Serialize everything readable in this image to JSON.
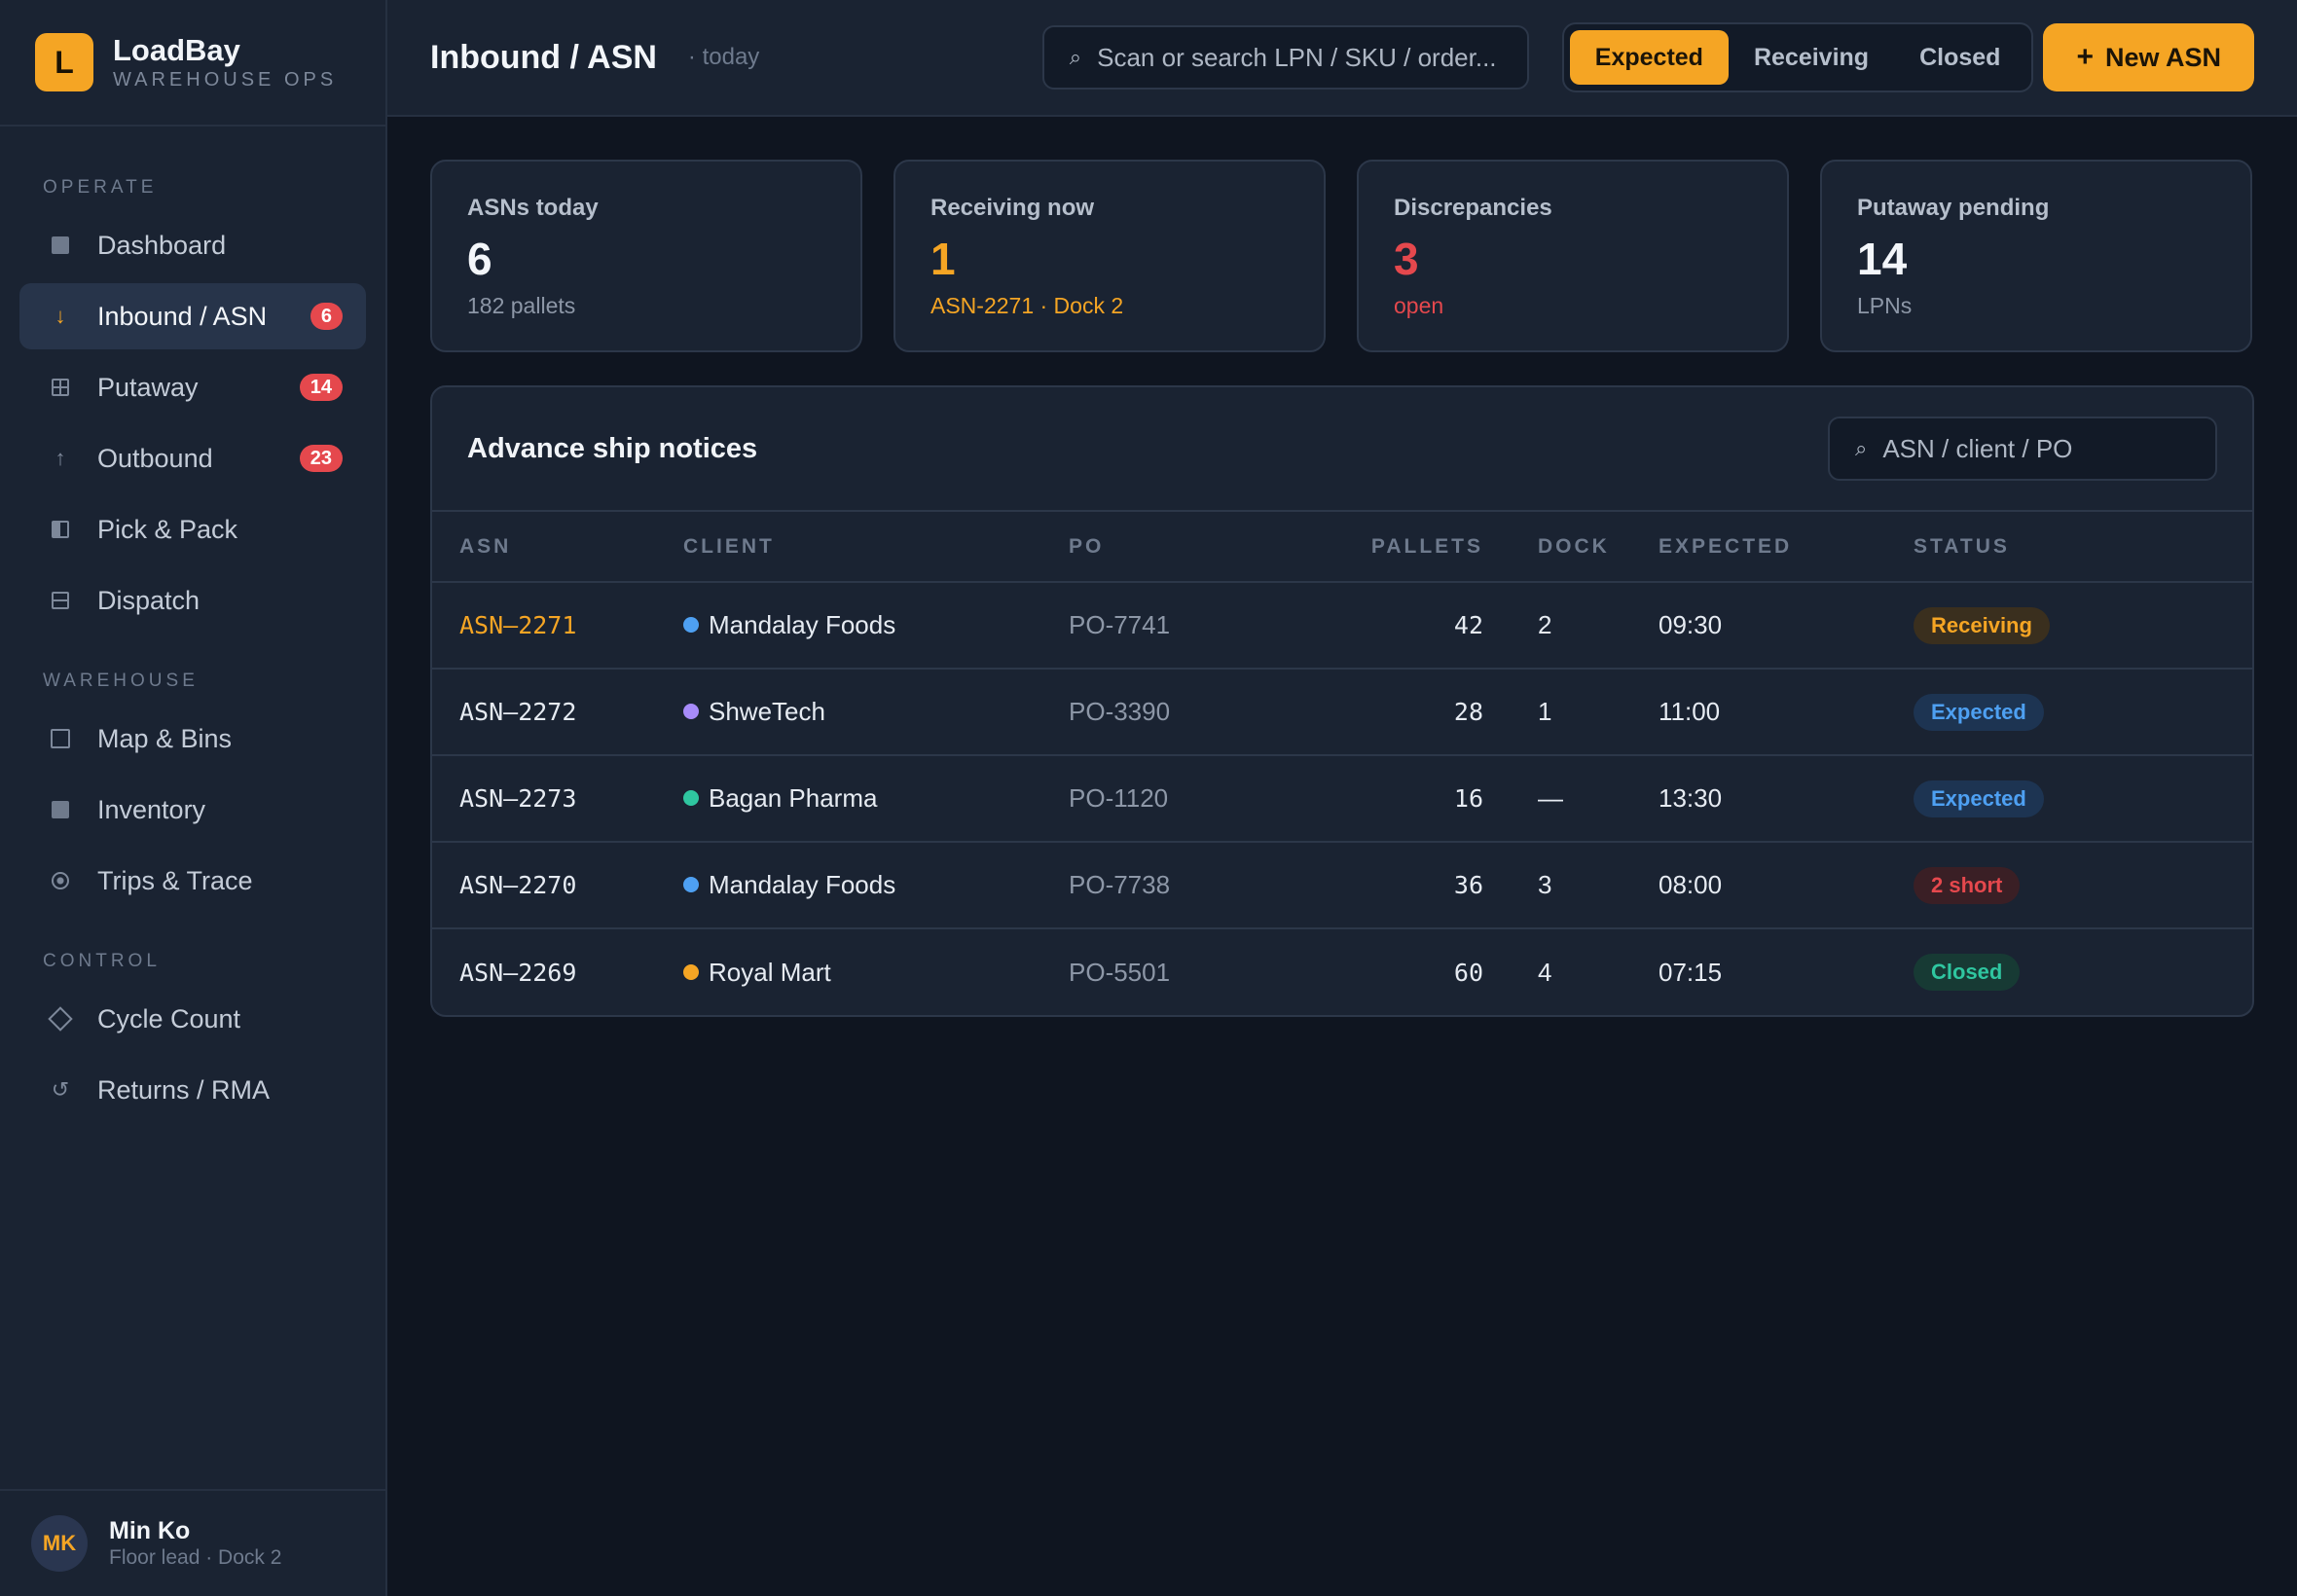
{
  "brand": {
    "logo_letter": "L",
    "name": "LoadBay",
    "subtitle": "WAREHOUSE OPS"
  },
  "nav": {
    "sections": [
      {
        "label": "OPERATE"
      },
      {
        "label": "WAREHOUSE"
      },
      {
        "label": "CONTROL"
      }
    ],
    "items": [
      {
        "label": "Dashboard",
        "icon": "dashboard-icon"
      },
      {
        "label": "Inbound / ASN",
        "icon": "arrow-down-icon",
        "badge": "6",
        "active": true
      },
      {
        "label": "Putaway",
        "icon": "grid-icon",
        "badge": "14"
      },
      {
        "label": "Outbound",
        "icon": "arrow-up-icon",
        "badge": "23"
      },
      {
        "label": "Pick & Pack",
        "icon": "pick-pack-icon"
      },
      {
        "label": "Dispatch",
        "icon": "dispatch-icon"
      },
      {
        "label": "Map & Bins",
        "icon": "map-icon"
      },
      {
        "label": "Inventory",
        "icon": "inventory-icon"
      },
      {
        "label": "Trips & Trace",
        "icon": "trace-icon"
      },
      {
        "label": "Cycle Count",
        "icon": "diamond-icon"
      },
      {
        "label": "Returns / RMA",
        "icon": "returns-icon"
      }
    ]
  },
  "user": {
    "initials": "MK",
    "name": "Min Ko",
    "role": "Floor lead · Dock 2"
  },
  "header": {
    "title": "Inbound / ASN",
    "subtitle": "· today",
    "search_placeholder": "Scan or search LPN / SKU / order...",
    "filters": [
      "Expected",
      "Receiving",
      "Closed"
    ],
    "active_filter": "Expected",
    "new_button": "New ASN"
  },
  "stats": [
    {
      "label": "ASNs today",
      "value": "6",
      "note": "182 pallets"
    },
    {
      "label": "Receiving now",
      "value": "1",
      "note": "ASN-2271 · Dock 2"
    },
    {
      "label": "Discrepancies",
      "value": "3",
      "note": "open"
    },
    {
      "label": "Putaway pending",
      "value": "14",
      "note": "LPNs"
    }
  ],
  "panel": {
    "title": "Advance ship notices",
    "search_placeholder": "ASN / client / PO",
    "columns": [
      "ASN",
      "CLIENT",
      "PO",
      "PALLETS",
      "DOCK",
      "EXPECTED",
      "STATUS"
    ],
    "rows": [
      {
        "asn": "ASN–2271",
        "client": "Mandalay Foods",
        "client_color": "#4ea0f2",
        "po": "PO-7741",
        "pallets": "42",
        "dock": "2",
        "expected": "09:30",
        "status": "Receiving",
        "status_kind": "receiving"
      },
      {
        "asn": "ASN–2272",
        "client": "ShweTech",
        "client_color": "#a78bfa",
        "po": "PO-3390",
        "pallets": "28",
        "dock": "1",
        "expected": "11:00",
        "status": "Expected",
        "status_kind": "expected"
      },
      {
        "asn": "ASN–2273",
        "client": "Bagan Pharma",
        "client_color": "#2fc6a0",
        "po": "PO-1120",
        "pallets": "16",
        "dock": "—",
        "expected": "13:30",
        "status": "Expected",
        "status_kind": "expected"
      },
      {
        "asn": "ASN–2270",
        "client": "Mandalay Foods",
        "client_color": "#4ea0f2",
        "po": "PO-7738",
        "pallets": "36",
        "dock": "3",
        "expected": "08:00",
        "status": "2 short",
        "status_kind": "short"
      },
      {
        "asn": "ASN–2269",
        "client": "Royal Mart",
        "client_color": "#f5a524",
        "po": "PO-5501",
        "pallets": "60",
        "dock": "4",
        "expected": "07:15",
        "status": "Closed",
        "status_kind": "closed"
      }
    ]
  },
  "colors": {
    "accent": "#f5a524",
    "danger": "#e5484d",
    "info": "#4ea0f2",
    "success": "#2fc6a0"
  }
}
